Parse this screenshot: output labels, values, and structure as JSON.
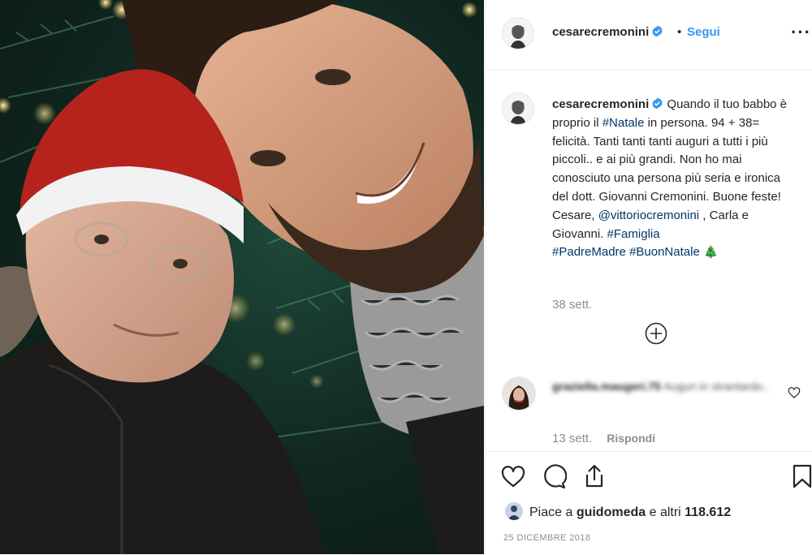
{
  "header": {
    "username": "cesarecremonini",
    "dot": "•",
    "follow_label": "Segui",
    "more_icon": "more-horizontal-icon"
  },
  "caption": {
    "username": "cesarecremonini",
    "t1": " Quando il tuo babbo è proprio il ",
    "tag1": "#Natale",
    "t2": " in persona. 94 + 38= felicità. Tanti tanti tanti auguri a tutti i più piccoli.. e ai più grandi. Non ho mai conosciuto una persona più seria e ironica del dott. Giovanni Cremonini. Buone feste! Cesare, ",
    "mention": "@vittoriocremonini",
    "t3": " , Carla e Giovanni. ",
    "tag2": "#Famiglia",
    "tag3": "#PadreMadre",
    "tag4": "#BuonNatale",
    "emoji": "🎄",
    "time": "38 sett."
  },
  "comment": {
    "username": "graziella.maugeri.75",
    "text": "Auguri in strantardo..",
    "time": "13 sett.",
    "reply_label": "Rispondi"
  },
  "likes": {
    "prefix": "Piace a ",
    "user": "guidomeda",
    "middle": " e altri ",
    "count": "118.612"
  },
  "date": "25 DICEMBRE 2018",
  "colors": {
    "link": "#003569",
    "follow": "#3897f0",
    "verified": "#3897f0",
    "muted": "#8e8e8e"
  }
}
